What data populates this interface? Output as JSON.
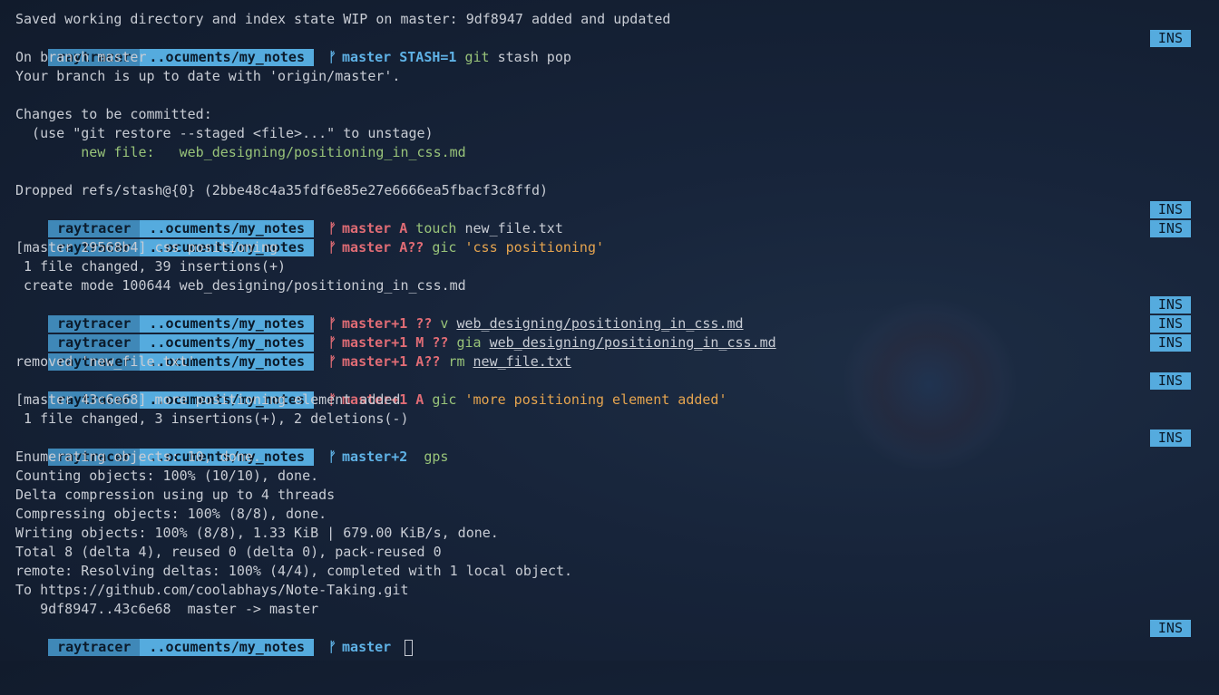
{
  "colors": {
    "accent_dark": "#3f88b8",
    "accent_light": "#55abde",
    "branch_blue": "#5fb2e6",
    "branch_red": "#e06c75",
    "string": "#e5a44f",
    "cmd": "#98c379"
  },
  "prompt": {
    "user": "raytracer",
    "dir": "..ocuments/my_notes",
    "branch_icon": "ᚠ",
    "mode": "INS"
  },
  "lines": {
    "l0": "Saved working directory and index state WIP on master: 9df8947 added and updated",
    "p1": {
      "branch": "master STASH=1",
      "cmd": "git",
      "args": " stash pop"
    },
    "l2": "On branch master",
    "l3": "Your branch is up to date with 'origin/master'.",
    "l5": "Changes to be committed:",
    "l6": "  (use \"git restore --staged <file>...\" to unstage)",
    "l7a": "        new file:   ",
    "l7b": "web_designing/positioning_in_css.md",
    "l9": "Dropped refs/stash@{0} (2bbe48c4a35fdf6e85e27e6666ea5fbacf3c8ffd)",
    "p10": {
      "branch": "master A",
      "cmd": "touch",
      "args": " new_file.txt"
    },
    "p11": {
      "branch": "master A??",
      "cmd": "gic",
      "str": "'css positioning'"
    },
    "l12": "[master 29568b4] css positioning",
    "l13": " 1 file changed, 39 insertions(+)",
    "l14": " create mode 100644 web_designing/positioning_in_css.md",
    "p15": {
      "branch": "master+1 ??",
      "cmd": "v",
      "arg": "web_designing/positioning_in_css.md"
    },
    "p16": {
      "branch": "master+1 M ??",
      "cmd": "gia",
      "arg": "web_designing/positioning_in_css.md"
    },
    "p17": {
      "branch": "master+1 A??",
      "cmd": "rm",
      "arg": "new_file.txt"
    },
    "l18": "removed 'new_file.txt'",
    "p19": {
      "branch": "master+1 A",
      "cmd": "gic",
      "str": "'more positioning element added'"
    },
    "l20": "[master 43c6e68] more positioning element added",
    "l21": " 1 file changed, 3 insertions(+), 2 deletions(-)",
    "p22": {
      "branch": "master+2",
      "cmd": "gps"
    },
    "l23": "Enumerating objects: 10, done.",
    "l24": "Counting objects: 100% (10/10), done.",
    "l25": "Delta compression using up to 4 threads",
    "l26": "Compressing objects: 100% (8/8), done.",
    "l27": "Writing objects: 100% (8/8), 1.33 KiB | 679.00 KiB/s, done.",
    "l28": "Total 8 (delta 4), reused 0 (delta 0), pack-reused 0",
    "l29": "remote: Resolving deltas: 100% (4/4), completed with 1 local object.",
    "l30": "To https://github.com/coolabhays/Note-Taking.git",
    "l31": "   9df8947..43c6e68  master -> master",
    "p32": {
      "branch": "master"
    }
  }
}
